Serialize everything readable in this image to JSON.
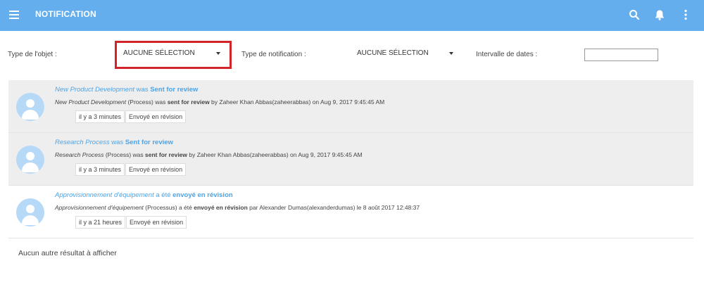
{
  "appbar": {
    "title": "NOTIFICATION",
    "bg_color": "#64aeee",
    "icons": [
      "menu-icon",
      "search-icon",
      "bell-icon",
      "more-vert-icon"
    ]
  },
  "filters": {
    "object_type": {
      "label": "Type de l'objet :",
      "value": "AUCUNE SÉLECTION"
    },
    "notification_type": {
      "label": "Type de notification :",
      "value": "AUCUNE SÉLECTION"
    },
    "date_range": {
      "label": "Intervalle de dates :",
      "value": ""
    },
    "highlight_color": "#d2232a"
  },
  "notifications": [
    {
      "title_item": "New Product Development",
      "title_mid": " was ",
      "title_action": "Sent for review",
      "detail_item": "New Product Development",
      "detail_type": " (Process) was ",
      "detail_action": "sent for review",
      "detail_rest": " by Zaheer Khan Abbas(zaheerabbas) on Aug 9, 2017 9:45:45 AM",
      "time": "il y a 3 minutes",
      "status": "Envoyé en révision"
    },
    {
      "title_item": "Research Process",
      "title_mid": " was ",
      "title_action": "Sent for review",
      "detail_item": "Research Process",
      "detail_type": " (Process) was ",
      "detail_action": "sent for review",
      "detail_rest": " by Zaheer Khan Abbas(zaheerabbas) on Aug 9, 2017 9:45:45 AM",
      "time": "il y a 3 minutes",
      "status": "Envoyé en révision"
    },
    {
      "title_item": "Approvisionnement d'équipement",
      "title_mid": " a été ",
      "title_action": "envoyé en révision",
      "detail_item": "Approvisionnement d'équipement",
      "detail_type": " (Processus) a été ",
      "detail_action": "envoyé en révision",
      "detail_rest": " par Alexander Dumas(alexanderdumas) le 8 août 2017 12:48:37",
      "time": "il y a 21 heures",
      "status": "Envoyé en révision"
    }
  ],
  "footer": {
    "text": "Aucun autre résultat à afficher"
  }
}
